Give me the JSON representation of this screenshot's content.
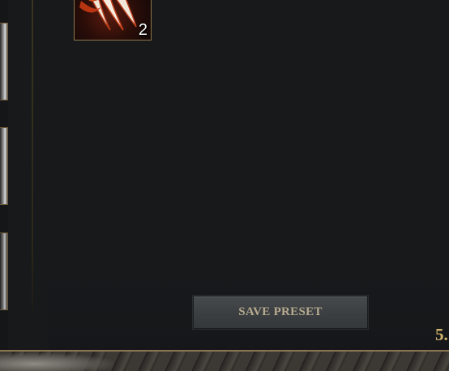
{
  "skill_bar": {
    "slot_1": {
      "icon": "claw-icon",
      "count": "2"
    }
  },
  "left_column": {
    "thumbnails": [
      "portrait-icon",
      "portrait-icon",
      "portrait-icon"
    ]
  },
  "actions": {
    "save_preset_label": "SAVE PRESET"
  },
  "status": {
    "corner_value": "5."
  },
  "colors": {
    "background": "#17191b",
    "button_bg": "#3f4346",
    "button_text": "#b7aa8f",
    "gold_accent": "#d2b46b",
    "border_gold": "#8c774b"
  }
}
